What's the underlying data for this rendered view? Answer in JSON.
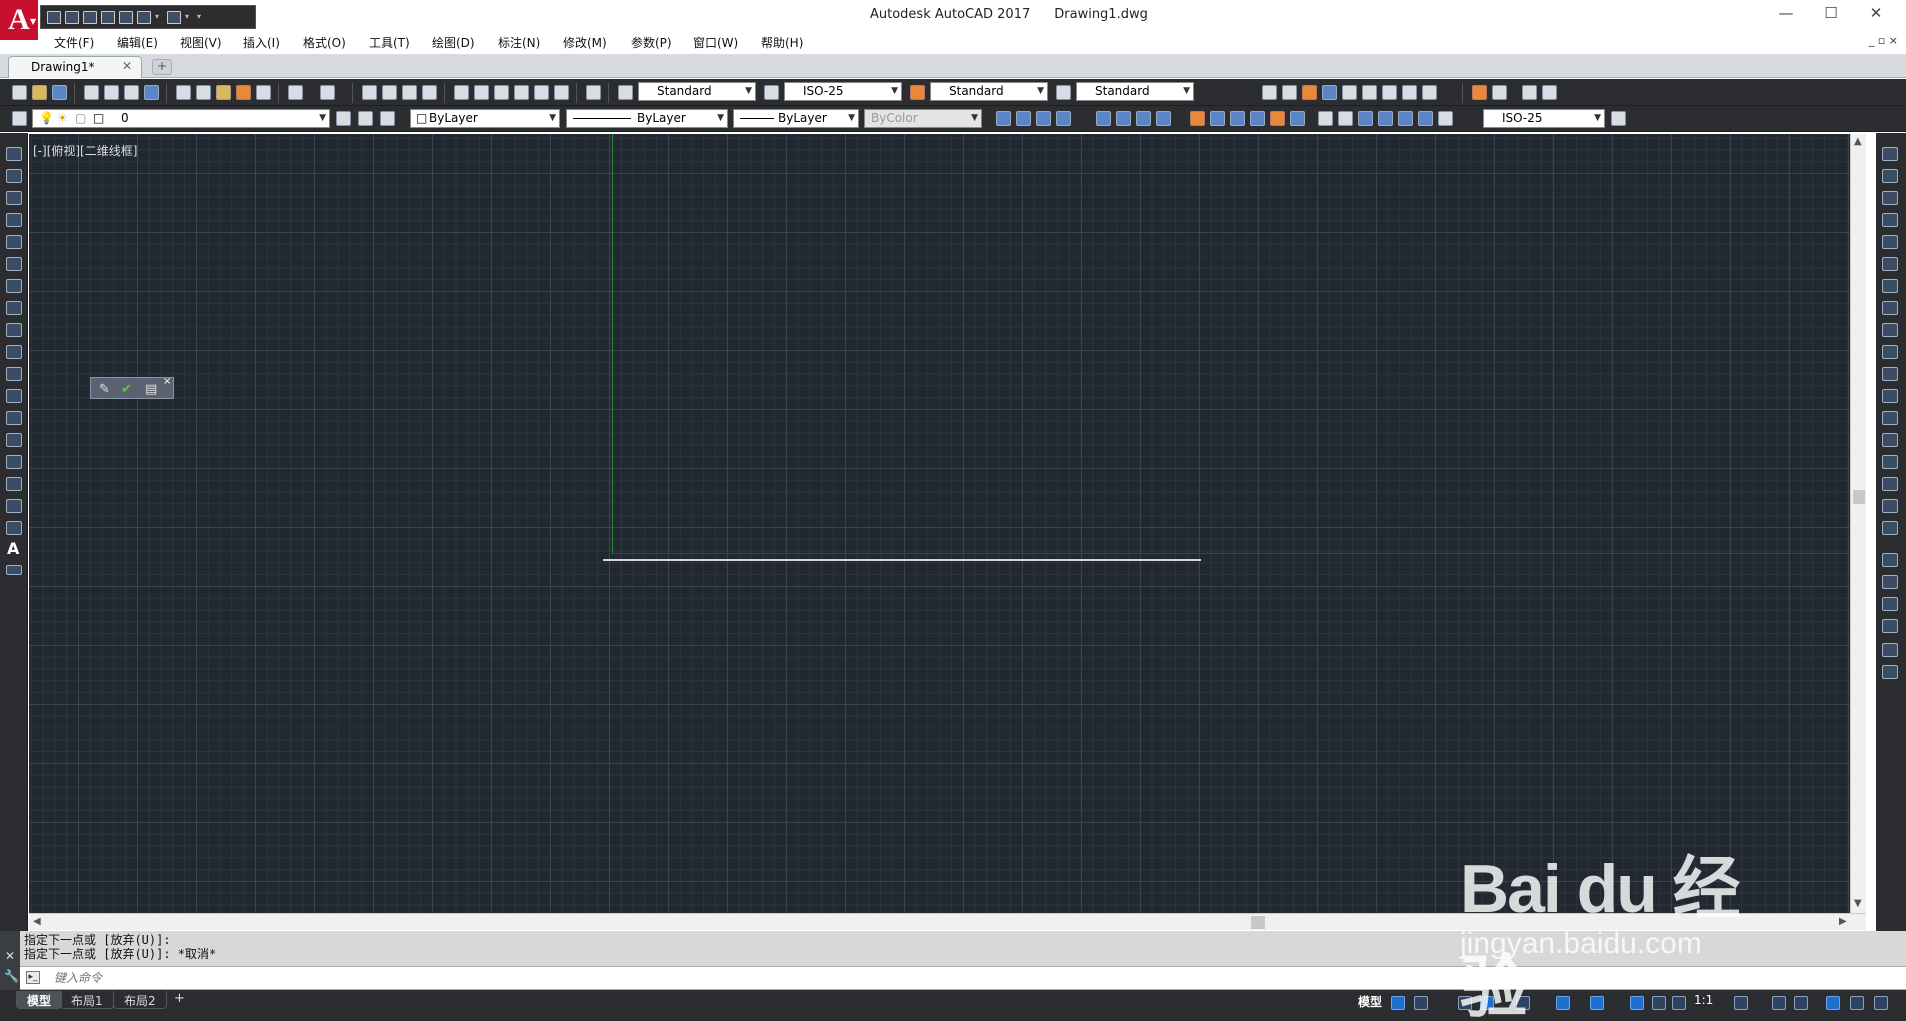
{
  "app": {
    "logo_letter": "A",
    "product": "Autodesk AutoCAD 2017",
    "document": "Drawing1.dwg",
    "window_controls": [
      "—",
      "☐",
      "✕"
    ]
  },
  "menu": [
    "文件(F)",
    "编辑(E)",
    "视图(V)",
    "插入(I)",
    "格式(O)",
    "工具(T)",
    "绘图(D)",
    "标注(N)",
    "修改(M)",
    "参数(P)",
    "窗口(W)",
    "帮助(H)"
  ],
  "menu_right_controls": "_ ▫ ×",
  "tabs": {
    "active": "Drawing1*",
    "close": "✕",
    "add": "+"
  },
  "styles_toolbar": {
    "text_style": "Standard",
    "dim_style": "ISO-25",
    "table_style": "Standard",
    "multileader_style": "Standard"
  },
  "properties_toolbar": {
    "layer": "0",
    "color": "ByLayer",
    "linetype": "ByLayer",
    "lineweight": "ByLayer",
    "plot_style": "ByColor",
    "dim_style": "ISO-25"
  },
  "viewport": {
    "label": "[-][俯视][二维线框]",
    "background": "#212830",
    "x_axis_color": "#8e2626",
    "y_axis_color": "#2f8a3a",
    "line_color": "#d6d6d6"
  },
  "mini_toolbar": {
    "ok": "✔",
    "close": "×"
  },
  "command_line": {
    "history": [
      "指定下一点或 [放弃(U)]:",
      "指定下一点或 [放弃(U)]: *取消*"
    ],
    "placeholder": "键入命令"
  },
  "layout_tabs": [
    "模型",
    "布局1",
    "布局2"
  ],
  "layout_add": "+",
  "status_bar": {
    "model": "模型",
    "scale": "1:1"
  },
  "watermark": {
    "brand": "Bai du 经验",
    "url": "jingyan.baidu.com"
  }
}
